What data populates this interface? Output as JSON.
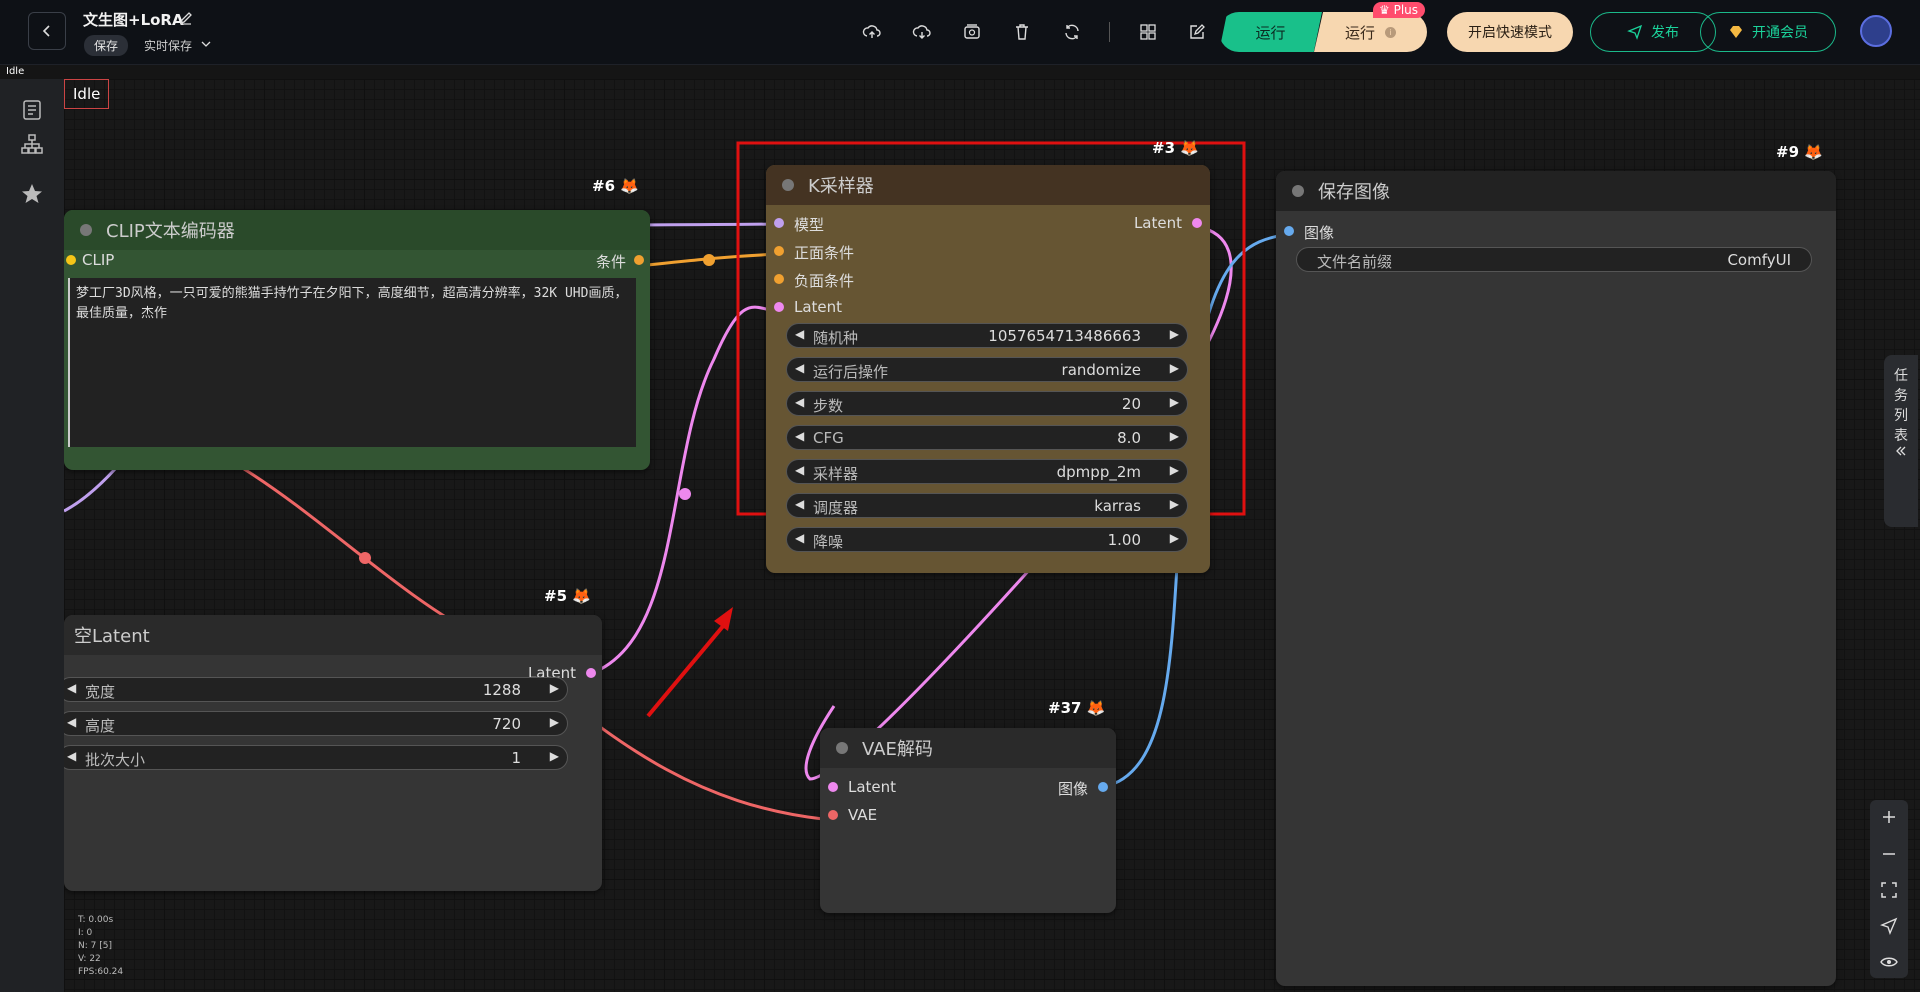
{
  "header": {
    "title": "文生图+LoRA",
    "save_label": "保存",
    "autosave_label": "实时保存",
    "run_label": "运行",
    "run_plus_label": "运行",
    "plus_badge": "Plus",
    "quick_mode_label": "开启快速模式",
    "publish_label": "发布",
    "member_label": "开通会员"
  },
  "status": {
    "top": "Idle",
    "canvas": "Idle"
  },
  "sidebar": {
    "icons": [
      "document-icon",
      "workflow-tree-icon",
      "star-icon"
    ]
  },
  "right_panel": {
    "task_list_label": [
      "任",
      "务",
      "列",
      "表"
    ]
  },
  "nodes": {
    "clip": {
      "badge": "#6 🦊",
      "title": "CLIP文本编码器",
      "input_clip": "CLIP",
      "output_cond": "条件",
      "prompt": "梦工厂3D风格，一只可爱的熊猫手持竹子在夕阳下，高度细节，超高清分辨率，32K UHD画质，最佳质量，杰作"
    },
    "ksampler": {
      "badge": "#3 🦊",
      "title": "K采样器",
      "in_model": "模型",
      "in_pos": "正面条件",
      "in_neg": "负面条件",
      "in_latent": "Latent",
      "out_latent": "Latent",
      "widgets": [
        {
          "label": "随机种",
          "value": "1057654713486663"
        },
        {
          "label": "运行后操作",
          "value": "randomize"
        },
        {
          "label": "步数",
          "value": "20"
        },
        {
          "label": "CFG",
          "value": "8.0"
        },
        {
          "label": "采样器",
          "value": "dpmpp_2m"
        },
        {
          "label": "调度器",
          "value": "karras"
        },
        {
          "label": "降噪",
          "value": "1.00"
        }
      ]
    },
    "save": {
      "badge": "#9 🦊",
      "title": "保存图像",
      "in_image": "图像",
      "prefix_label": "文件名前缀",
      "prefix_value": "ComfyUI"
    },
    "latent": {
      "badge": "#5 🦊",
      "title": "空Latent",
      "out_latent": "Latent",
      "widgets": [
        {
          "label": "宽度",
          "value": "1288"
        },
        {
          "label": "高度",
          "value": "720"
        },
        {
          "label": "批次大小",
          "value": "1"
        }
      ]
    },
    "vae": {
      "badge": "#37 🦊",
      "title": "VAE解码",
      "in_latent": "Latent",
      "in_vae": "VAE",
      "out_image": "图像"
    }
  },
  "perf": {
    "t": "T: 0.00s",
    "i": "I: 0",
    "n": "N: 7 [5]",
    "v": "V: 22",
    "fps": "FPS:60.24"
  },
  "colors": {
    "accent_green": "#19c08a",
    "plus_bg": "#f7d7b0",
    "highlight": "#e01010"
  }
}
